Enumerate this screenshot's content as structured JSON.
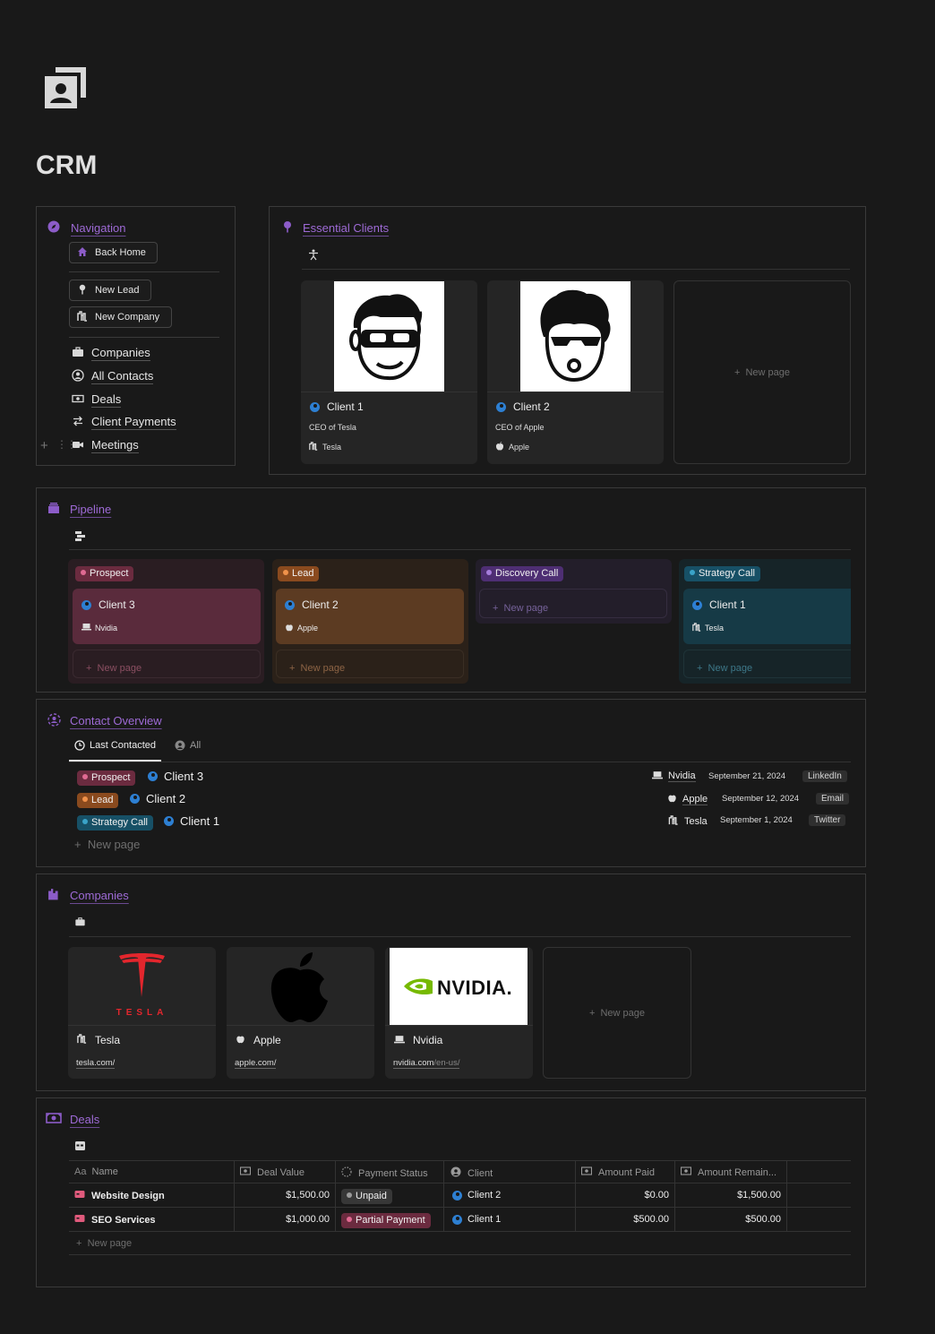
{
  "page": {
    "title": "CRM"
  },
  "navigation": {
    "title": "Navigation",
    "buttons": [
      "Back Home",
      "New Lead",
      "New Company"
    ],
    "items": [
      "Companies",
      "All Contacts",
      "Deals",
      "Client Payments",
      "Meetings"
    ]
  },
  "essential_clients": {
    "title": "Essential Clients",
    "cards": [
      {
        "name": "Client 1",
        "role": "CEO of Tesla",
        "company": "Tesla"
      },
      {
        "name": "Client 2",
        "role": "CEO of Apple",
        "company": "Apple"
      }
    ],
    "new_page": "New page"
  },
  "pipeline": {
    "title": "Pipeline",
    "columns": [
      {
        "label": "Prospect",
        "card_name": "Client 3",
        "card_company": "Nvidia",
        "new_page": "New page"
      },
      {
        "label": "Lead",
        "card_name": "Client 2",
        "card_company": "Apple",
        "new_page": "New page"
      },
      {
        "label": "Discovery Call",
        "new_page": "New page"
      },
      {
        "label": "Strategy Call",
        "card_name": "Client 1",
        "card_company": "Tesla",
        "new_page": "New page"
      }
    ]
  },
  "contact_overview": {
    "title": "Contact Overview",
    "tabs": [
      "Last Contacted",
      "All"
    ],
    "rows": [
      {
        "stage": "Prospect",
        "client": "Client 3",
        "company": "Nvidia",
        "date": "September 21, 2024",
        "source": "LinkedIn"
      },
      {
        "stage": "Lead",
        "client": "Client 2",
        "company": "Apple",
        "date": "September 12, 2024",
        "source": "Email"
      },
      {
        "stage": "Strategy Call",
        "client": "Client 1",
        "company": "Tesla",
        "date": "September 1, 2024",
        "source": "Twitter"
      }
    ],
    "new_page": "New page"
  },
  "companies": {
    "title": "Companies",
    "cards": [
      {
        "name": "Tesla",
        "url": "tesla.com/",
        "url_extra": "",
        "logo_text": "TESLA"
      },
      {
        "name": "Apple",
        "url": "apple.com/",
        "url_extra": ""
      },
      {
        "name": "Nvidia",
        "url": "nvidia.com",
        "url_extra": "/en-us/",
        "logo_text": "NVIDIA."
      }
    ],
    "new_page": "New page"
  },
  "deals": {
    "title": "Deals",
    "columns": [
      "Name",
      "Deal Value",
      "Payment Status",
      "Client",
      "Amount Paid",
      "Amount Remain..."
    ],
    "column_icons": [
      "Aa"
    ],
    "rows": [
      {
        "name": "Website Design",
        "value": "$1,500.00",
        "status": "Unpaid",
        "client": "Client 2",
        "paid": "$0.00",
        "remaining": "$1,500.00"
      },
      {
        "name": "SEO Services",
        "value": "$1,000.00",
        "status": "Partial Payment",
        "client": "Client 1",
        "paid": "$500.00",
        "remaining": "$500.00"
      }
    ],
    "new_page": "New page"
  },
  "colors": {
    "accent": "#9e6ad6",
    "prospect": "#6b2b3f",
    "lead": "#8a4a1e",
    "discovery": "#4e2e73",
    "strategy": "#175066"
  }
}
